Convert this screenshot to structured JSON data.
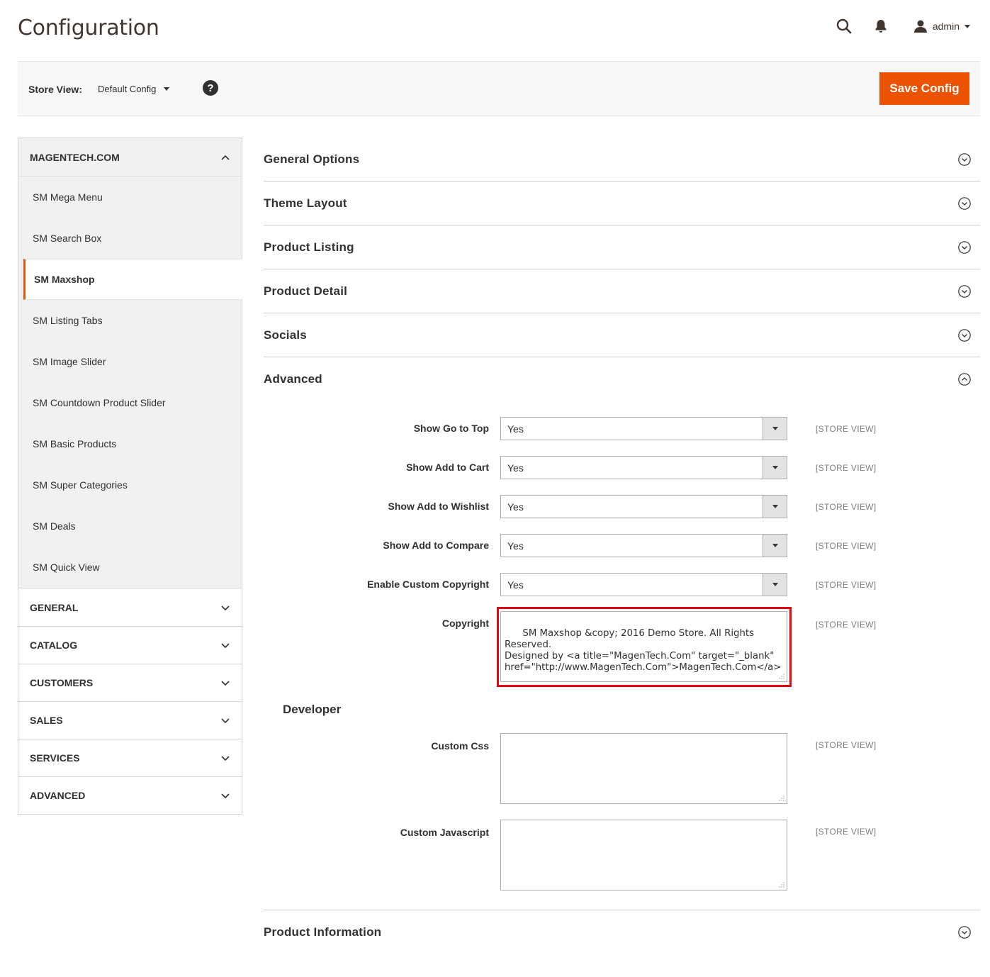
{
  "header": {
    "title": "Configuration",
    "user": "admin"
  },
  "store_bar": {
    "label": "Store View:",
    "selected": "Default Config",
    "help": "?",
    "save_label": "Save Config"
  },
  "sidebar": {
    "main_group": "MAGENTECH.COM",
    "items": [
      {
        "label": "SM Mega Menu"
      },
      {
        "label": "SM Search Box"
      },
      {
        "label": "SM Maxshop"
      },
      {
        "label": "SM Listing Tabs"
      },
      {
        "label": "SM Image Slider"
      },
      {
        "label": "SM Countdown Product Slider"
      },
      {
        "label": "SM Basic Products"
      },
      {
        "label": "SM Super Categories"
      },
      {
        "label": "SM Deals"
      },
      {
        "label": "SM Quick View"
      }
    ],
    "active_item": "SM Maxshop",
    "groups": [
      {
        "label": "GENERAL"
      },
      {
        "label": "CATALOG"
      },
      {
        "label": "CUSTOMERS"
      },
      {
        "label": "SALES"
      },
      {
        "label": "SERVICES"
      },
      {
        "label": "ADVANCED"
      }
    ]
  },
  "sections": [
    {
      "title": "General Options"
    },
    {
      "title": "Theme Layout"
    },
    {
      "title": "Product Listing"
    },
    {
      "title": "Product Detail"
    },
    {
      "title": "Socials"
    },
    {
      "title": "Advanced"
    }
  ],
  "advanced": {
    "fields": [
      {
        "label": "Show Go to Top",
        "value": "Yes",
        "scope": "[STORE VIEW]"
      },
      {
        "label": "Show Add to Cart",
        "value": "Yes",
        "scope": "[STORE VIEW]"
      },
      {
        "label": "Show Add to Wishlist",
        "value": "Yes",
        "scope": "[STORE VIEW]"
      },
      {
        "label": "Show Add to Compare",
        "value": "Yes",
        "scope": "[STORE VIEW]"
      },
      {
        "label": "Enable Custom Copyright",
        "value": "Yes",
        "scope": "[STORE VIEW]"
      }
    ],
    "copyright": {
      "label": "Copyright",
      "value": "SM Maxshop &copy; 2016 Demo Store. All Rights Reserved.\nDesigned by <a title=\"MagenTech.Com\" target=\"_blank\"\nhref=\"http://www.MagenTech.Com\">MagenTech.Com</a>",
      "scope": "[STORE VIEW]"
    },
    "developer": {
      "title": "Developer",
      "custom_css": {
        "label": "Custom Css",
        "value": "",
        "scope": "[STORE VIEW]"
      },
      "custom_js": {
        "label": "Custom Javascript",
        "value": "",
        "scope": "[STORE VIEW]"
      }
    }
  },
  "last_section": {
    "title": "Product Information"
  },
  "colors": {
    "accent": "#eb5202",
    "highlight": "#e30613"
  }
}
